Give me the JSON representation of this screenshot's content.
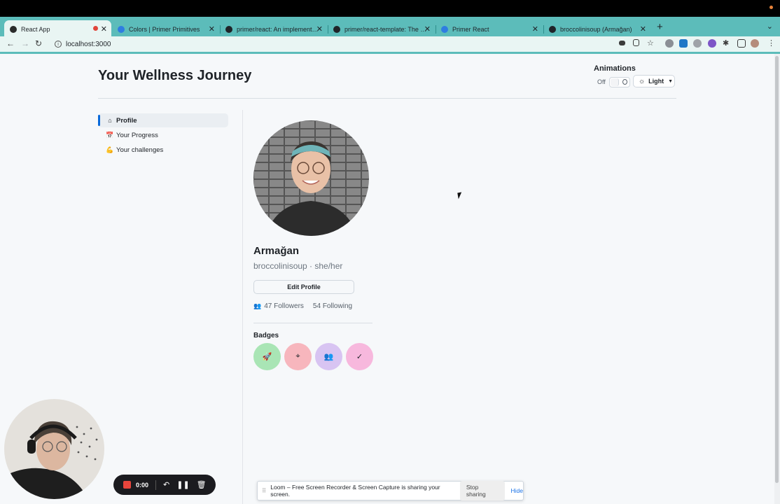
{
  "browser": {
    "tabs": [
      {
        "title": "React App",
        "favicon_color": "#2b2b2b",
        "active": true,
        "recording": true
      },
      {
        "title": "Colors | Primer Primitives",
        "favicon_color": "#2f7de1",
        "active": false
      },
      {
        "title": "primer/react: An implementation",
        "favicon_color": "#1f2328",
        "active": false
      },
      {
        "title": "primer/react-template: The qu",
        "favicon_color": "#1f2328",
        "active": false
      },
      {
        "title": "Primer React",
        "favicon_color": "#2f7de1",
        "active": false
      },
      {
        "title": "broccolinisoup (Armağan)",
        "favicon_color": "#1f2328",
        "active": false
      }
    ],
    "url": "localhost:3000"
  },
  "header": {
    "title": "Your Wellness Journey",
    "animations_label": "Animations",
    "toggle_label": "Off",
    "theme_label": "Light"
  },
  "sidenav": {
    "items": [
      {
        "label": "Profile",
        "icon": "home-icon",
        "glyph": "⌂",
        "active": true
      },
      {
        "label": "Your Progress",
        "icon": "calendar-icon",
        "glyph": "📅",
        "active": false
      },
      {
        "label": "Your challenges",
        "icon": "flexed-bicep-icon",
        "glyph": "💪",
        "active": false
      }
    ]
  },
  "profile": {
    "name": "Armağan",
    "handle": "broccolinisoup · she/her",
    "edit_label": "Edit Profile",
    "followers": "47 Followers",
    "following": "54 Following",
    "badges_title": "Badges",
    "badges": [
      {
        "icon": "rocket-icon",
        "glyph": "🚀",
        "color": "#a9e5b5"
      },
      {
        "icon": "location-pin-icon",
        "glyph": "⌖",
        "color": "#f7b6bd"
      },
      {
        "icon": "people-icon",
        "glyph": "👥",
        "color": "#d8c4f2"
      },
      {
        "icon": "check-icon",
        "glyph": "✓",
        "color": "#f7b8dd"
      }
    ]
  },
  "recorder": {
    "time": "0:00"
  },
  "share_notice": {
    "message": "Loom – Free Screen Recorder & Screen Capture is sharing your screen.",
    "stop_label": "Stop sharing",
    "hide_label": "Hide"
  },
  "colors": {
    "accent": "#0969da",
    "tabstrip": "#5cbcba"
  }
}
